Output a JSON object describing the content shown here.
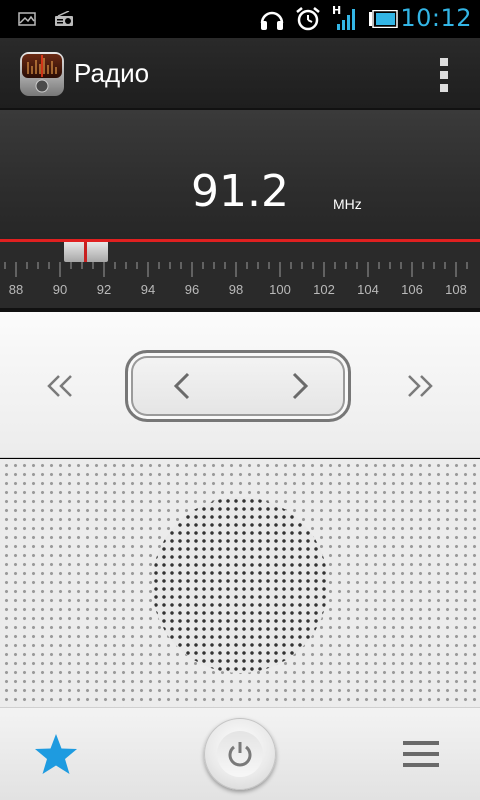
{
  "status_bar": {
    "time": "10:12",
    "icons": [
      "gallery-icon",
      "radio-icon",
      "headset-icon",
      "alarm-icon",
      "signal-icon",
      "battery-icon"
    ],
    "network_label": "H",
    "accent_color": "#33b5e5"
  },
  "action_bar": {
    "title": "Радио",
    "overflow_icon": "overflow-menu-icon"
  },
  "tuner": {
    "frequency": "91.2",
    "unit": "MHz",
    "scale_labels": [
      "88",
      "90",
      "92",
      "94",
      "96",
      "98",
      "100",
      "102",
      "104",
      "106",
      "108"
    ],
    "needle_value": 91.2,
    "indicator_color": "#e02020"
  },
  "controls": {
    "seek_back_icon": "double-chevron-left-icon",
    "prev_icon": "chevron-left-icon",
    "next_icon": "chevron-right-icon",
    "seek_forward_icon": "double-chevron-right-icon"
  },
  "bottom_bar": {
    "favorite_icon": "star-icon",
    "favorite_color": "#1e9be0",
    "power_icon": "power-icon",
    "menu_icon": "list-menu-icon"
  }
}
